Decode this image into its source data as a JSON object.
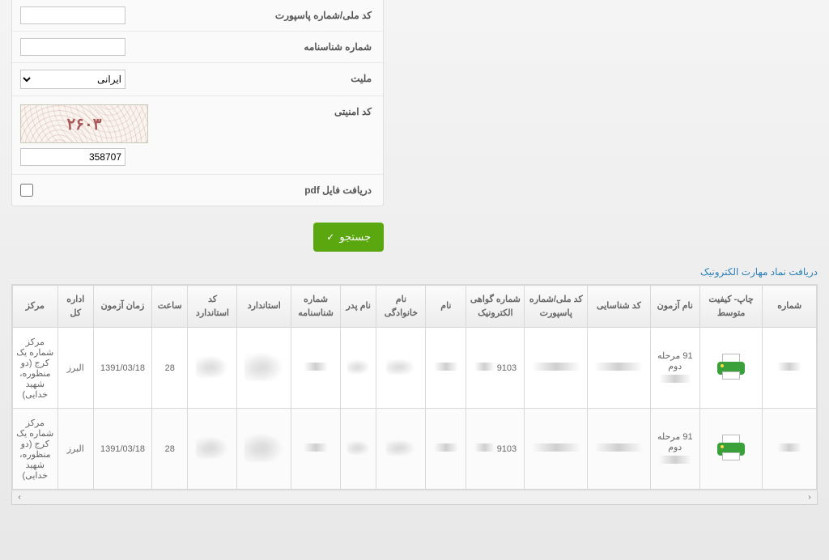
{
  "form": {
    "row1": {
      "label": "کد ملی/شماره پاسپورت",
      "value": ""
    },
    "row2": {
      "label": "شماره شناسنامه",
      "value": ""
    },
    "row3": {
      "label": "ملیت",
      "selected": "ایرانی"
    },
    "row4": {
      "label": "کد امنیتی",
      "captcha_display": "۲۶۰۳",
      "input_value": "358707"
    },
    "row5": {
      "label": "دریافت فایل pdf"
    }
  },
  "actions": {
    "search": "جستجو"
  },
  "link": {
    "elec": "دریافت نماد مهارت الکترونیک"
  },
  "table": {
    "headers": {
      "num": "شماره",
      "print": "چاپ- کیفیت متوسط",
      "azmoon": "نام آزمون",
      "shenasa": "کد شناسایی",
      "meli": "کد ملی/شماره پاسپورت",
      "govahi": "شماره گواهی الکترونیک",
      "nam": "نام",
      "fam": "نام خانوادگی",
      "pedar": "نام پدر",
      "shsh": "شماره شناسنامه",
      "std": "استاندارد",
      "stdcode": "کد استاندارد",
      "saat": "ساعت",
      "zaman": "زمان آزمون",
      "edare": "اداره کل",
      "markaz": "مرکز"
    },
    "rows": [
      {
        "azmoon": "91 مرحله دوم",
        "govahi": "9103",
        "saat": "28",
        "zaman": "1391/03/18",
        "edare": "البرز",
        "markaz": "مرکز شماره یک کرج (دو منظوره، شهید خدایی)"
      },
      {
        "azmoon": "91 مرحله دوم",
        "govahi": "9103",
        "saat": "28",
        "zaman": "1391/03/18",
        "edare": "البرز",
        "markaz": "مرکز شماره یک کرج (دو منظوره، شهید خدایی)"
      }
    ]
  }
}
